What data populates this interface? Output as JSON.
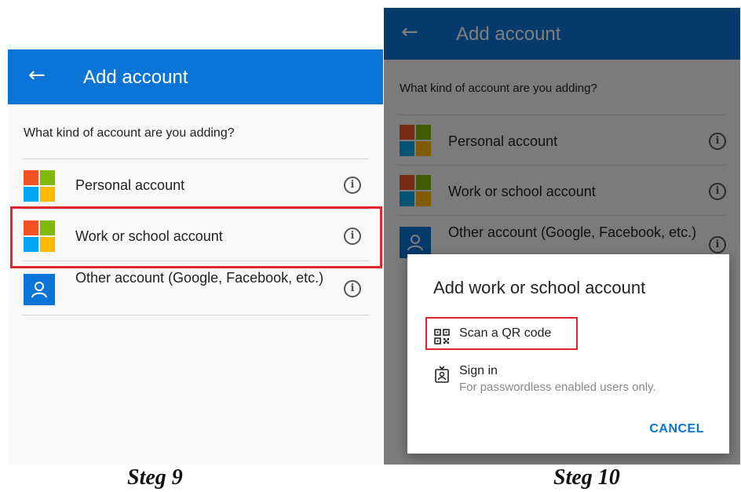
{
  "colors": {
    "accent": "#0b74d7",
    "highlight": "#e0262d"
  },
  "left": {
    "app_bar": {
      "back_icon": "arrow-left-icon",
      "title": "Add account"
    },
    "prompt": "What kind of account are you adding?",
    "accounts": [
      {
        "label": "Personal account",
        "icon": "microsoft-logo-icon"
      },
      {
        "label": "Work or school account",
        "icon": "microsoft-logo-icon",
        "highlighted": true
      },
      {
        "label": "Other account (Google, Facebook, etc.)",
        "icon": "person-icon"
      }
    ],
    "caption": "Steg 9"
  },
  "right": {
    "app_bar": {
      "back_icon": "arrow-left-icon",
      "title": "Add account"
    },
    "prompt": "What kind of account are you adding?",
    "accounts": [
      {
        "label": "Personal account"
      },
      {
        "label": "Work or school account"
      },
      {
        "label": "Other account (Google, Facebook, etc.)"
      }
    ],
    "dialog": {
      "title": "Add work or school account",
      "scan_label": "Scan a QR code",
      "scan_icon": "qr-code-icon",
      "signin_label": "Sign in",
      "signin_sub": "For passwordless enabled users only.",
      "signin_icon": "badge-icon",
      "cancel_label": "CANCEL"
    },
    "caption": "Steg 10"
  }
}
